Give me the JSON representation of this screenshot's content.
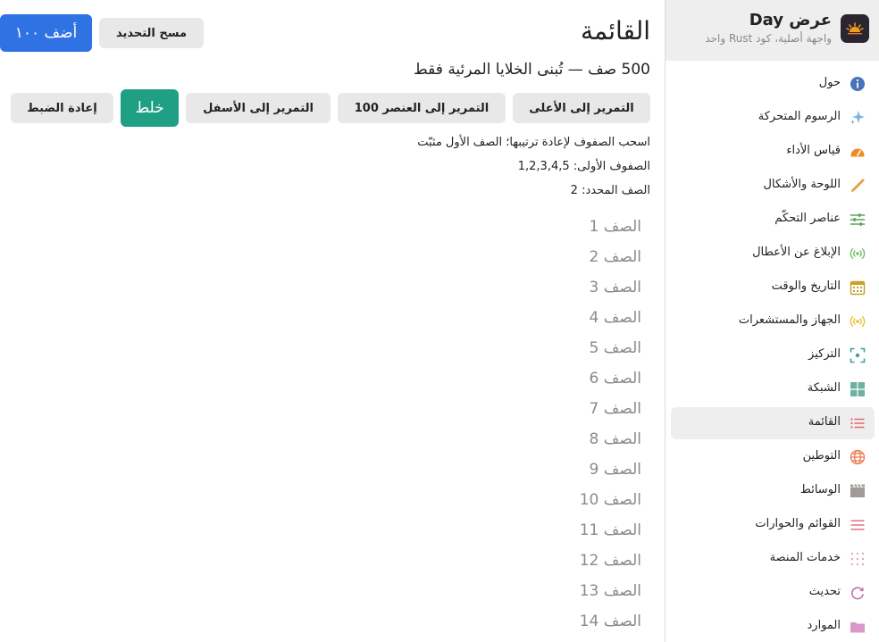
{
  "app": {
    "title": "عرض Day",
    "subtitle": "واجهة أصلية، كود Rust واحد"
  },
  "sidebar": {
    "items": [
      {
        "label": "حول",
        "icon": "info-icon",
        "color": "#4a74b8"
      },
      {
        "label": "الرسوم المتحركة",
        "icon": "sparkles-icon",
        "color": "#7fb0e0"
      },
      {
        "label": "قياس الأداء",
        "icon": "speedometer-icon",
        "color": "#f08a24"
      },
      {
        "label": "اللوحة والأشكال",
        "icon": "brush-icon",
        "color": "#e8a24a"
      },
      {
        "label": "عناصر التحكّم",
        "icon": "sliders-icon",
        "color": "#5aa35a"
      },
      {
        "label": "الإبلاغ عن الأعطال",
        "icon": "broadcast-icon",
        "color": "#6cbf6c"
      },
      {
        "label": "التاريخ والوقت",
        "icon": "calendar-icon",
        "color": "#c9a227"
      },
      {
        "label": "الجهاز والمستشعرات",
        "icon": "sensor-icon",
        "color": "#e8c030"
      },
      {
        "label": "التركيز",
        "icon": "focus-icon",
        "color": "#3aa39a"
      },
      {
        "label": "الشبكة",
        "icon": "grid-icon",
        "color": "#6fb0a0"
      },
      {
        "label": "القائمة",
        "icon": "list-icon",
        "color": "#e06060",
        "active": true
      },
      {
        "label": "التوطين",
        "icon": "globe-icon",
        "color": "#f07850"
      },
      {
        "label": "الوسائط",
        "icon": "film-icon",
        "color": "#a09a98"
      },
      {
        "label": "القوائم والحوارات",
        "icon": "menu-icon",
        "color": "#e06a7a"
      },
      {
        "label": "خدمات المنصة",
        "icon": "dots-grid-icon",
        "color": "#d8a0c0"
      },
      {
        "label": "تحديث",
        "icon": "refresh-icon",
        "color": "#c070b0"
      },
      {
        "label": "الموارد",
        "icon": "folder-icon",
        "color": "#d898c8"
      }
    ]
  },
  "main": {
    "title": "القائمة",
    "clear_selection": "مسح التحديد",
    "add_hundred": "أضف ١٠٠",
    "subtitle": "500 صف — تُبنى الخلايا المرئية فقط",
    "scroll_top": "التمرير إلى الأعلى",
    "scroll_item": "التمرير إلى العنصر 100",
    "scroll_bottom": "التمرير إلى الأسفل",
    "shuffle": "خلط",
    "reset": "إعادة الضبط",
    "hint": "اسحب الصفوف لإعادة ترتيبها؛ الصف الأول مثبّت",
    "first_rows": "الصفوف الأولى: 1,2,3,4,5",
    "selected_row": "الصف المحدد: 2",
    "rows": [
      "الصف 1",
      "الصف 2",
      "الصف 3",
      "الصف 4",
      "الصف 5",
      "الصف 6",
      "الصف 7",
      "الصف 8",
      "الصف 9",
      "الصف 10",
      "الصف 11",
      "الصف 12",
      "الصف 13",
      "الصف 14"
    ]
  },
  "colors": {
    "accent_blue": "#2f72e4",
    "accent_green": "#1fa085",
    "sidebar_header": "#eeeeee"
  }
}
